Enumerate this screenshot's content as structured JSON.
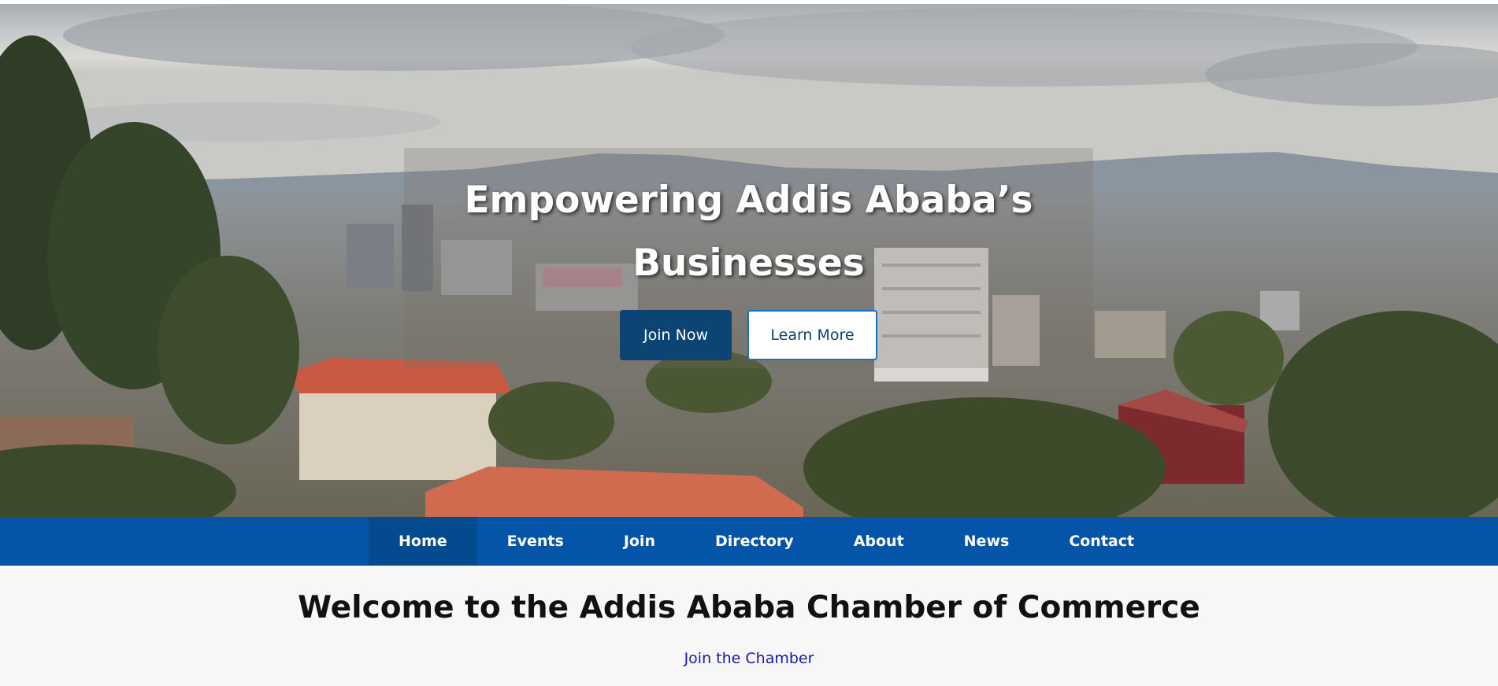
{
  "hero": {
    "title": "Empowering Addis Ababa’s Businesses",
    "primary_button": "Join Now",
    "secondary_button": "Learn More",
    "image": "addis-ababa-cityscape"
  },
  "nav": {
    "items": [
      {
        "label": "Home",
        "active": true
      },
      {
        "label": "Events",
        "active": false
      },
      {
        "label": "Join",
        "active": false
      },
      {
        "label": "Directory",
        "active": false
      },
      {
        "label": "About",
        "active": false
      },
      {
        "label": "News",
        "active": false
      },
      {
        "label": "Contact",
        "active": false
      }
    ]
  },
  "main": {
    "title": "Welcome to the Addis Ababa Chamber of Commerce",
    "link": "Join the Chamber"
  },
  "colors": {
    "nav_bg": "#0454a8",
    "nav_active": "#034a8f",
    "primary_button": "#0c4474",
    "link": "#1a1aa6",
    "page_bg": "#f7f7f7"
  }
}
